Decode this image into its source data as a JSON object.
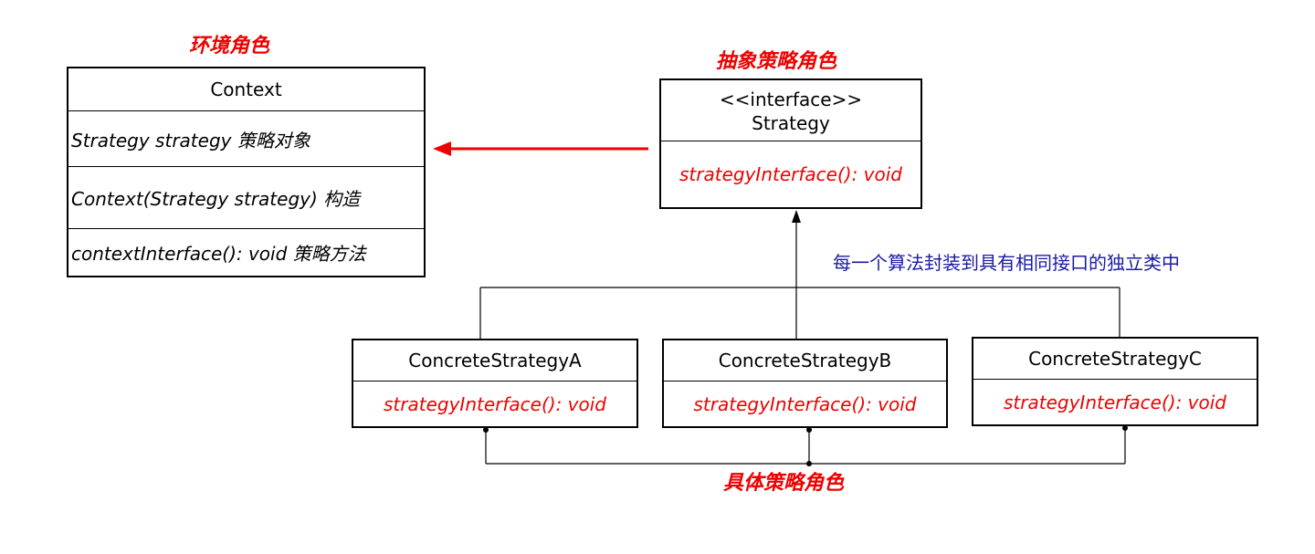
{
  "colors": {
    "accent": "#ee0000",
    "note": "#1a1aa6",
    "line": "#000000"
  },
  "labels": {
    "context_role": "环境角色",
    "abstract_role": "抽象策略角色",
    "concrete_role": "具体策略角色",
    "note": "每一个算法封装到具有相同接口的独立类中"
  },
  "context": {
    "name": "Context",
    "attribute": "Strategy strategy 策略对象",
    "constructor": "Context(Strategy strategy) 构造",
    "method": "contextInterface(): void 策略方法"
  },
  "strategy": {
    "stereotype": "<<interface>>",
    "name": "Strategy",
    "method": "strategyInterface(): void"
  },
  "concretes": [
    {
      "name": "ConcreteStrategyA",
      "method": "strategyInterface(): void"
    },
    {
      "name": "ConcreteStrategyB",
      "method": "strategyInterface(): void"
    },
    {
      "name": "ConcreteStrategyC",
      "method": "strategyInterface(): void"
    }
  ]
}
